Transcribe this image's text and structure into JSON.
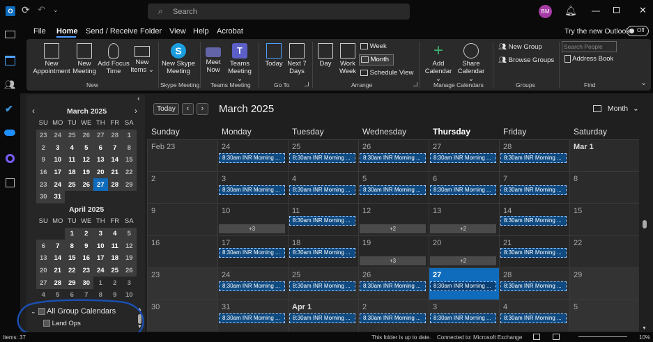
{
  "titlebar": {
    "search_placeholder": "Search",
    "avatar_initials": "BM"
  },
  "menu": {
    "items": [
      "File",
      "Home",
      "Send / Receive",
      "Folder",
      "View",
      "Help",
      "Acrobat"
    ],
    "try_new": "Try the new Outlook",
    "toggle": "Off"
  },
  "ribbon": {
    "new_appointment": "New\nAppointment",
    "new_meeting": "New\nMeeting",
    "add_focus_time": "Add Focus\nTime",
    "new_items": "New\nItems ⌄",
    "new_skype_meeting": "New Skype\nMeeting",
    "meet_now": "Meet\nNow",
    "teams_meeting": "Teams\nMeeting ⌄",
    "today": "Today",
    "next7": "Next 7\nDays",
    "day": "Day",
    "work_week": "Work\nWeek",
    "week": "Week",
    "month": "Month",
    "schedule_view": "Schedule View",
    "add_calendar": "Add\nCalendar ⌄",
    "share_calendar": "Share\nCalendar ⌄",
    "new_group": "New Group",
    "browse_groups": "Browse Groups",
    "search_people_placeholder": "Search People",
    "address_book": "Address Book",
    "groups_labels": [
      "New",
      "Skype Meeting",
      "Teams Meeting",
      "Go To",
      "Arrange",
      "Manage Calendars",
      "Groups",
      "Find"
    ]
  },
  "minical": {
    "march_title": "March 2025",
    "april_title": "April 2025",
    "dow": [
      "SU",
      "MO",
      "TU",
      "WE",
      "TH",
      "FR",
      "SA"
    ],
    "march_weeks": [
      [
        "23",
        "24",
        "25",
        "26",
        "27",
        "28",
        "1"
      ],
      [
        "2",
        "3",
        "4",
        "5",
        "6",
        "7",
        "8"
      ],
      [
        "9",
        "10",
        "11",
        "12",
        "13",
        "14",
        "15"
      ],
      [
        "16",
        "17",
        "18",
        "19",
        "20",
        "21",
        "22"
      ],
      [
        "23",
        "24",
        "25",
        "26",
        "27",
        "28",
        "29"
      ],
      [
        "30",
        "31",
        "",
        "",
        "",
        "",
        ""
      ]
    ],
    "april_weeks": [
      [
        "",
        "",
        "1",
        "2",
        "3",
        "4",
        "5"
      ],
      [
        "6",
        "7",
        "8",
        "9",
        "10",
        "11",
        "12"
      ],
      [
        "13",
        "14",
        "15",
        "16",
        "17",
        "18",
        "19"
      ],
      [
        "20",
        "21",
        "22",
        "23",
        "24",
        "25",
        "26"
      ],
      [
        "27",
        "28",
        "29",
        "30",
        "1",
        "2",
        "3"
      ],
      [
        "4",
        "5",
        "6",
        "7",
        "8",
        "9",
        "10"
      ]
    ],
    "group_header": "All Group Calendars",
    "group_item": "Land Ops"
  },
  "calendar": {
    "today_button": "Today",
    "title": "March 2025",
    "view": "Month",
    "days": [
      "Sunday",
      "Monday",
      "Tuesday",
      "Wednesday",
      "Thursday",
      "Friday",
      "Saturday"
    ],
    "weeks": [
      [
        "Feb 23",
        "24",
        "25",
        "26",
        "27",
        "28",
        "Mar 1"
      ],
      [
        "2",
        "3",
        "4",
        "5",
        "6",
        "7",
        "8"
      ],
      [
        "9",
        "10",
        "11",
        "12",
        "13",
        "14",
        "15"
      ],
      [
        "16",
        "17",
        "18",
        "19",
        "20",
        "21",
        "22"
      ],
      [
        "23",
        "24",
        "25",
        "26",
        "27",
        "28",
        "29"
      ],
      [
        "30",
        "31",
        "Apr 1",
        "2",
        "3",
        "4",
        "5"
      ]
    ],
    "event_label": "8:30am INR Morning ...",
    "more3": "+3",
    "more2": "+2",
    "accent": "#0f6cbd"
  },
  "status": {
    "items": "Items: 37",
    "uptodate": "This folder is up to date.",
    "connected": "Connected to: Microsoft Exchange",
    "zoom": "10%"
  }
}
